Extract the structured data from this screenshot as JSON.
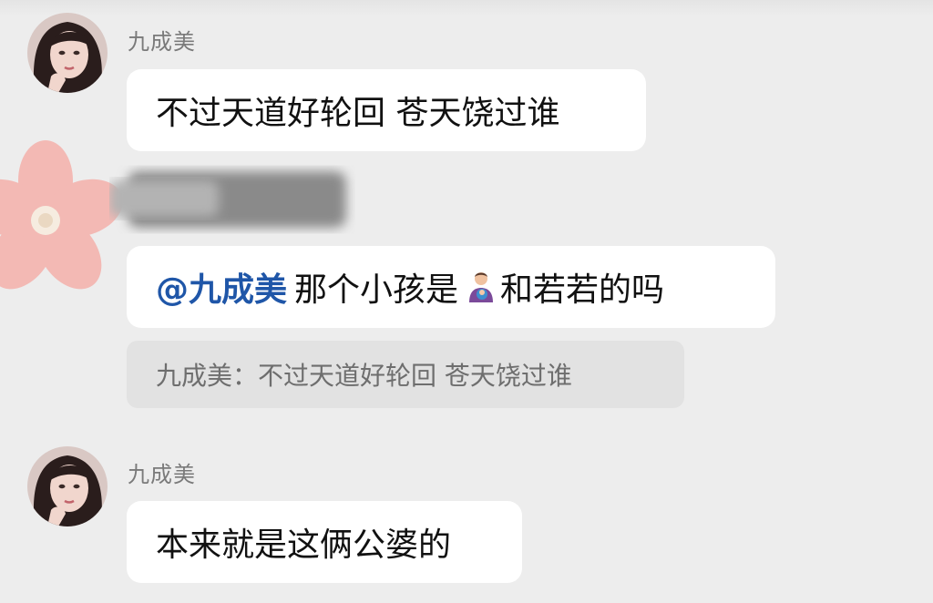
{
  "messages": [
    {
      "sender": "九成美",
      "avatar": "girl-portrait-avatar",
      "text": "不过天道好轮回 苍天饶过谁"
    },
    {
      "sender_avatar": "pink-flower-avatar",
      "sender_name_state": "blurred",
      "mention": "@九成美",
      "text_before_emoji": "那个小孩是",
      "emoji": "man-holding-baby-emoji",
      "text_after_emoji": "和若若的吗",
      "quote": "九成美：不过天道好轮回 苍天饶过谁"
    },
    {
      "sender": "九成美",
      "avatar": "girl-portrait-avatar",
      "text": "本来就是这俩公婆的"
    }
  ],
  "colors": {
    "background": "#ededed",
    "bubble": "#ffffff",
    "mention": "#1f56a8",
    "quote_bg": "#e2e2e2"
  }
}
